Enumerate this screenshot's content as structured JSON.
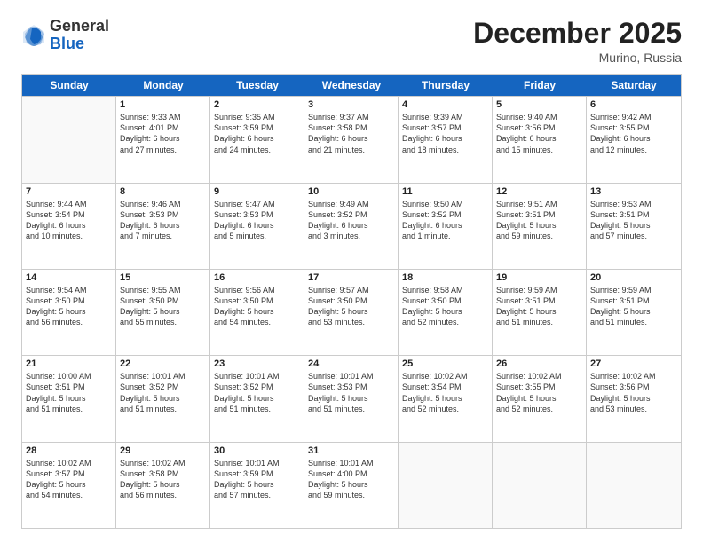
{
  "header": {
    "logo": {
      "general": "General",
      "blue": "Blue"
    },
    "title": "December 2025",
    "subtitle": "Murino, Russia"
  },
  "calendar": {
    "days": [
      "Sunday",
      "Monday",
      "Tuesday",
      "Wednesday",
      "Thursday",
      "Friday",
      "Saturday"
    ],
    "rows": [
      [
        {
          "num": "",
          "lines": []
        },
        {
          "num": "1",
          "lines": [
            "Sunrise: 9:33 AM",
            "Sunset: 4:01 PM",
            "Daylight: 6 hours",
            "and 27 minutes."
          ]
        },
        {
          "num": "2",
          "lines": [
            "Sunrise: 9:35 AM",
            "Sunset: 3:59 PM",
            "Daylight: 6 hours",
            "and 24 minutes."
          ]
        },
        {
          "num": "3",
          "lines": [
            "Sunrise: 9:37 AM",
            "Sunset: 3:58 PM",
            "Daylight: 6 hours",
            "and 21 minutes."
          ]
        },
        {
          "num": "4",
          "lines": [
            "Sunrise: 9:39 AM",
            "Sunset: 3:57 PM",
            "Daylight: 6 hours",
            "and 18 minutes."
          ]
        },
        {
          "num": "5",
          "lines": [
            "Sunrise: 9:40 AM",
            "Sunset: 3:56 PM",
            "Daylight: 6 hours",
            "and 15 minutes."
          ]
        },
        {
          "num": "6",
          "lines": [
            "Sunrise: 9:42 AM",
            "Sunset: 3:55 PM",
            "Daylight: 6 hours",
            "and 12 minutes."
          ]
        }
      ],
      [
        {
          "num": "7",
          "lines": [
            "Sunrise: 9:44 AM",
            "Sunset: 3:54 PM",
            "Daylight: 6 hours",
            "and 10 minutes."
          ]
        },
        {
          "num": "8",
          "lines": [
            "Sunrise: 9:46 AM",
            "Sunset: 3:53 PM",
            "Daylight: 6 hours",
            "and 7 minutes."
          ]
        },
        {
          "num": "9",
          "lines": [
            "Sunrise: 9:47 AM",
            "Sunset: 3:53 PM",
            "Daylight: 6 hours",
            "and 5 minutes."
          ]
        },
        {
          "num": "10",
          "lines": [
            "Sunrise: 9:49 AM",
            "Sunset: 3:52 PM",
            "Daylight: 6 hours",
            "and 3 minutes."
          ]
        },
        {
          "num": "11",
          "lines": [
            "Sunrise: 9:50 AM",
            "Sunset: 3:52 PM",
            "Daylight: 6 hours",
            "and 1 minute."
          ]
        },
        {
          "num": "12",
          "lines": [
            "Sunrise: 9:51 AM",
            "Sunset: 3:51 PM",
            "Daylight: 5 hours",
            "and 59 minutes."
          ]
        },
        {
          "num": "13",
          "lines": [
            "Sunrise: 9:53 AM",
            "Sunset: 3:51 PM",
            "Daylight: 5 hours",
            "and 57 minutes."
          ]
        }
      ],
      [
        {
          "num": "14",
          "lines": [
            "Sunrise: 9:54 AM",
            "Sunset: 3:50 PM",
            "Daylight: 5 hours",
            "and 56 minutes."
          ]
        },
        {
          "num": "15",
          "lines": [
            "Sunrise: 9:55 AM",
            "Sunset: 3:50 PM",
            "Daylight: 5 hours",
            "and 55 minutes."
          ]
        },
        {
          "num": "16",
          "lines": [
            "Sunrise: 9:56 AM",
            "Sunset: 3:50 PM",
            "Daylight: 5 hours",
            "and 54 minutes."
          ]
        },
        {
          "num": "17",
          "lines": [
            "Sunrise: 9:57 AM",
            "Sunset: 3:50 PM",
            "Daylight: 5 hours",
            "and 53 minutes."
          ]
        },
        {
          "num": "18",
          "lines": [
            "Sunrise: 9:58 AM",
            "Sunset: 3:50 PM",
            "Daylight: 5 hours",
            "and 52 minutes."
          ]
        },
        {
          "num": "19",
          "lines": [
            "Sunrise: 9:59 AM",
            "Sunset: 3:51 PM",
            "Daylight: 5 hours",
            "and 51 minutes."
          ]
        },
        {
          "num": "20",
          "lines": [
            "Sunrise: 9:59 AM",
            "Sunset: 3:51 PM",
            "Daylight: 5 hours",
            "and 51 minutes."
          ]
        }
      ],
      [
        {
          "num": "21",
          "lines": [
            "Sunrise: 10:00 AM",
            "Sunset: 3:51 PM",
            "Daylight: 5 hours",
            "and 51 minutes."
          ]
        },
        {
          "num": "22",
          "lines": [
            "Sunrise: 10:01 AM",
            "Sunset: 3:52 PM",
            "Daylight: 5 hours",
            "and 51 minutes."
          ]
        },
        {
          "num": "23",
          "lines": [
            "Sunrise: 10:01 AM",
            "Sunset: 3:52 PM",
            "Daylight: 5 hours",
            "and 51 minutes."
          ]
        },
        {
          "num": "24",
          "lines": [
            "Sunrise: 10:01 AM",
            "Sunset: 3:53 PM",
            "Daylight: 5 hours",
            "and 51 minutes."
          ]
        },
        {
          "num": "25",
          "lines": [
            "Sunrise: 10:02 AM",
            "Sunset: 3:54 PM",
            "Daylight: 5 hours",
            "and 52 minutes."
          ]
        },
        {
          "num": "26",
          "lines": [
            "Sunrise: 10:02 AM",
            "Sunset: 3:55 PM",
            "Daylight: 5 hours",
            "and 52 minutes."
          ]
        },
        {
          "num": "27",
          "lines": [
            "Sunrise: 10:02 AM",
            "Sunset: 3:56 PM",
            "Daylight: 5 hours",
            "and 53 minutes."
          ]
        }
      ],
      [
        {
          "num": "28",
          "lines": [
            "Sunrise: 10:02 AM",
            "Sunset: 3:57 PM",
            "Daylight: 5 hours",
            "and 54 minutes."
          ]
        },
        {
          "num": "29",
          "lines": [
            "Sunrise: 10:02 AM",
            "Sunset: 3:58 PM",
            "Daylight: 5 hours",
            "and 56 minutes."
          ]
        },
        {
          "num": "30",
          "lines": [
            "Sunrise: 10:01 AM",
            "Sunset: 3:59 PM",
            "Daylight: 5 hours",
            "and 57 minutes."
          ]
        },
        {
          "num": "31",
          "lines": [
            "Sunrise: 10:01 AM",
            "Sunset: 4:00 PM",
            "Daylight: 5 hours",
            "and 59 minutes."
          ]
        },
        {
          "num": "",
          "lines": []
        },
        {
          "num": "",
          "lines": []
        },
        {
          "num": "",
          "lines": []
        }
      ]
    ]
  }
}
